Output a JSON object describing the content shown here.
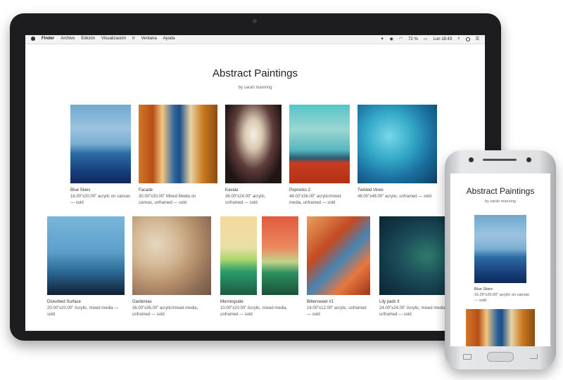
{
  "menubar": {
    "items": [
      "Finder",
      "Archivo",
      "Edición",
      "Visualización",
      "Ir",
      "Ventana",
      "Ayuda"
    ],
    "battery": "72 %",
    "clock": "Lun 18:43"
  },
  "gallery": {
    "title": "Abstract Paintings",
    "byline": "by sarah manning",
    "paintings": [
      {
        "title": "Blue Skies",
        "details": "16.00\"x20.00\" acrylic on canvas — sold"
      },
      {
        "title": "Facade",
        "details": "30.00\"x30.00\" Mixed Media on canvas, unframed — sold"
      },
      {
        "title": "Kavala",
        "details": "36.00\"x24.00\" acrylic, unframed — sold"
      },
      {
        "title": "Poprocks 2",
        "details": "48.00\"x36.00\" acrylic/mixed media, unframed — sold"
      },
      {
        "title": "Twisted Vines",
        "details": "48.00\"x48.00\" acrylic, unframed — sold"
      },
      {
        "title": "Disturbed Surface",
        "details": "20.00\"x20.00\" Acrylic, mixed media — sold"
      },
      {
        "title": "Gardenias",
        "details": "36.00\"x36.00\" acrylic/mixed media, unframed — sold"
      },
      {
        "title": "Morningside",
        "details": "10.00\"x20.00\" Acrylic, mixed media, unframed — sold"
      },
      {
        "title": "Bittersweet #1",
        "details": "16.00\"x12.00\" acrylic, unframed — sold"
      },
      {
        "title": "Lily pads II",
        "details": "24.00\"x24.00\" Acrylic, mixed media, unframed — sold"
      }
    ]
  },
  "phone": {
    "title": "Abstract Paintings",
    "byline": "by sarah manning",
    "painting": {
      "title": "Blue Skies",
      "details": "16.00\"x20.00\" acrylic on canvas — sold"
    }
  }
}
